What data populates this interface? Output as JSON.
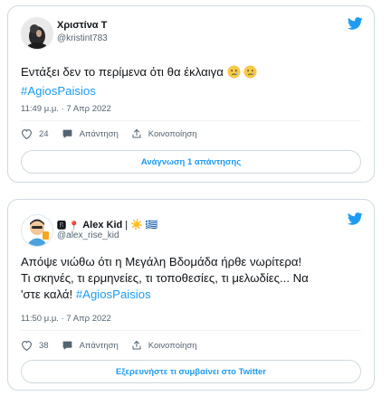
{
  "tweets": [
    {
      "display_name": "Χριστίνα Τ",
      "handle": "@kristint783",
      "text": "Εντάξει δεν το περίμενα ότι θα έκλαιγα",
      "emojis": [
        "crying-face",
        "crying-face"
      ],
      "hashtag": "#AgiosPaisios",
      "timestamp": "11:49 μ.μ. · 7 Απρ 2022",
      "like_count": "24",
      "reply_label": "Απάντηση",
      "share_label": "Κοινοποίηση",
      "footer_button": "Ανάγνωση 1 απάντησης"
    },
    {
      "display_name_prefix": "🅱 📍",
      "display_name": "Alex Kid",
      "display_name_suffix": "| ☀️ 🇬🇷",
      "handle": "@alex_rise_kid",
      "text_line1": "Απόψε νιώθω ότι η Μεγάλη Βδομάδα ήρθε νωρίτερα!",
      "text_line2": "Τι σκηνές, τι ερμηνείες, τι τοποθεσίες, τι μελωδίες... Να",
      "text_line3": "'στε καλά!",
      "hashtag": "#AgiosPaisios",
      "timestamp": "11:50 μ.μ. · 7 Απρ 2022",
      "like_count": "38",
      "reply_label": "Απάντηση",
      "share_label": "Κοινοποίηση",
      "footer_button": "Εξερευνήστε τι συμβαίνει στο Twitter"
    }
  ],
  "colors": {
    "accent": "#1d9bf0",
    "border": "#cfd9de",
    "secondary": "#536471"
  }
}
